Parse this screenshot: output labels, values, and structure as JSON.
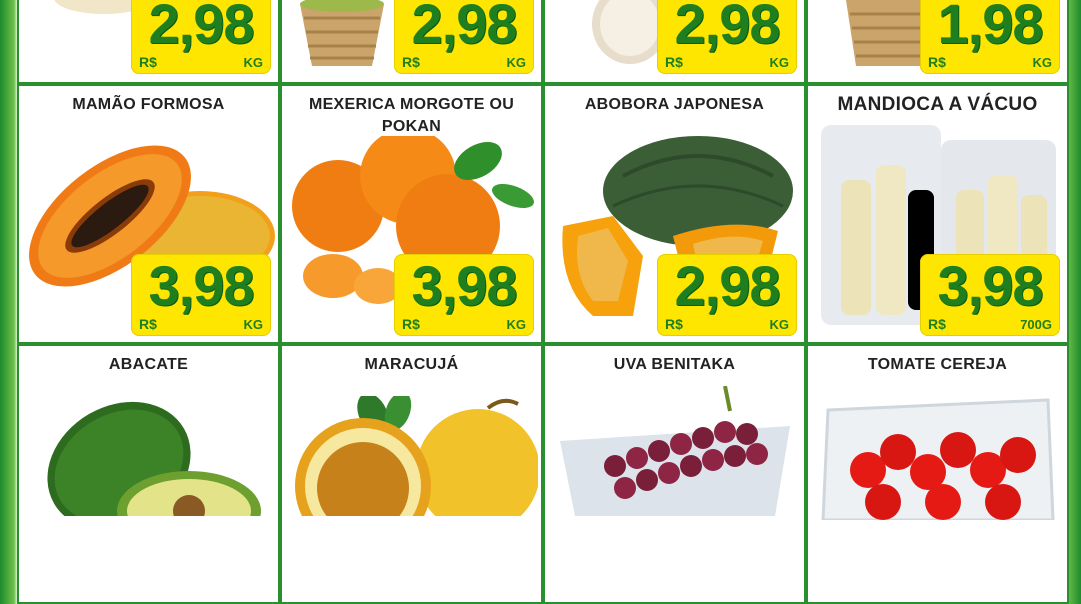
{
  "currency": "R$",
  "rows": [
    {
      "items": [
        {
          "name": "",
          "price": "2,98",
          "unit": "KG"
        },
        {
          "name": "",
          "price": "2,98",
          "unit": "KG"
        },
        {
          "name": "",
          "price": "2,98",
          "unit": "KG"
        },
        {
          "name": "",
          "price": "1,98",
          "unit": "KG"
        }
      ]
    },
    {
      "items": [
        {
          "name": "MAMÃO FORMOSA",
          "price": "3,98",
          "unit": "KG"
        },
        {
          "name": "MEXERICA MORGOTE OU POKAN",
          "price": "3,98",
          "unit": "KG"
        },
        {
          "name": "ABOBORA JAPONESA",
          "price": "2,98",
          "unit": "KG"
        },
        {
          "name": "MANDIOCA A VÁCUO",
          "price": "3,98",
          "unit": "700G"
        }
      ]
    },
    {
      "items": [
        {
          "name": "ABACATE",
          "price": "",
          "unit": ""
        },
        {
          "name": "MARACUJÁ",
          "price": "",
          "unit": ""
        },
        {
          "name": "UVA BENITAKA",
          "price": "",
          "unit": ""
        },
        {
          "name": "TOMATE CEREJA",
          "price": "",
          "unit": ""
        }
      ]
    }
  ],
  "colors": {
    "border_green": "#2a8f2e",
    "price_yellow": "#ffe600",
    "price_green": "#1f7f1f"
  }
}
